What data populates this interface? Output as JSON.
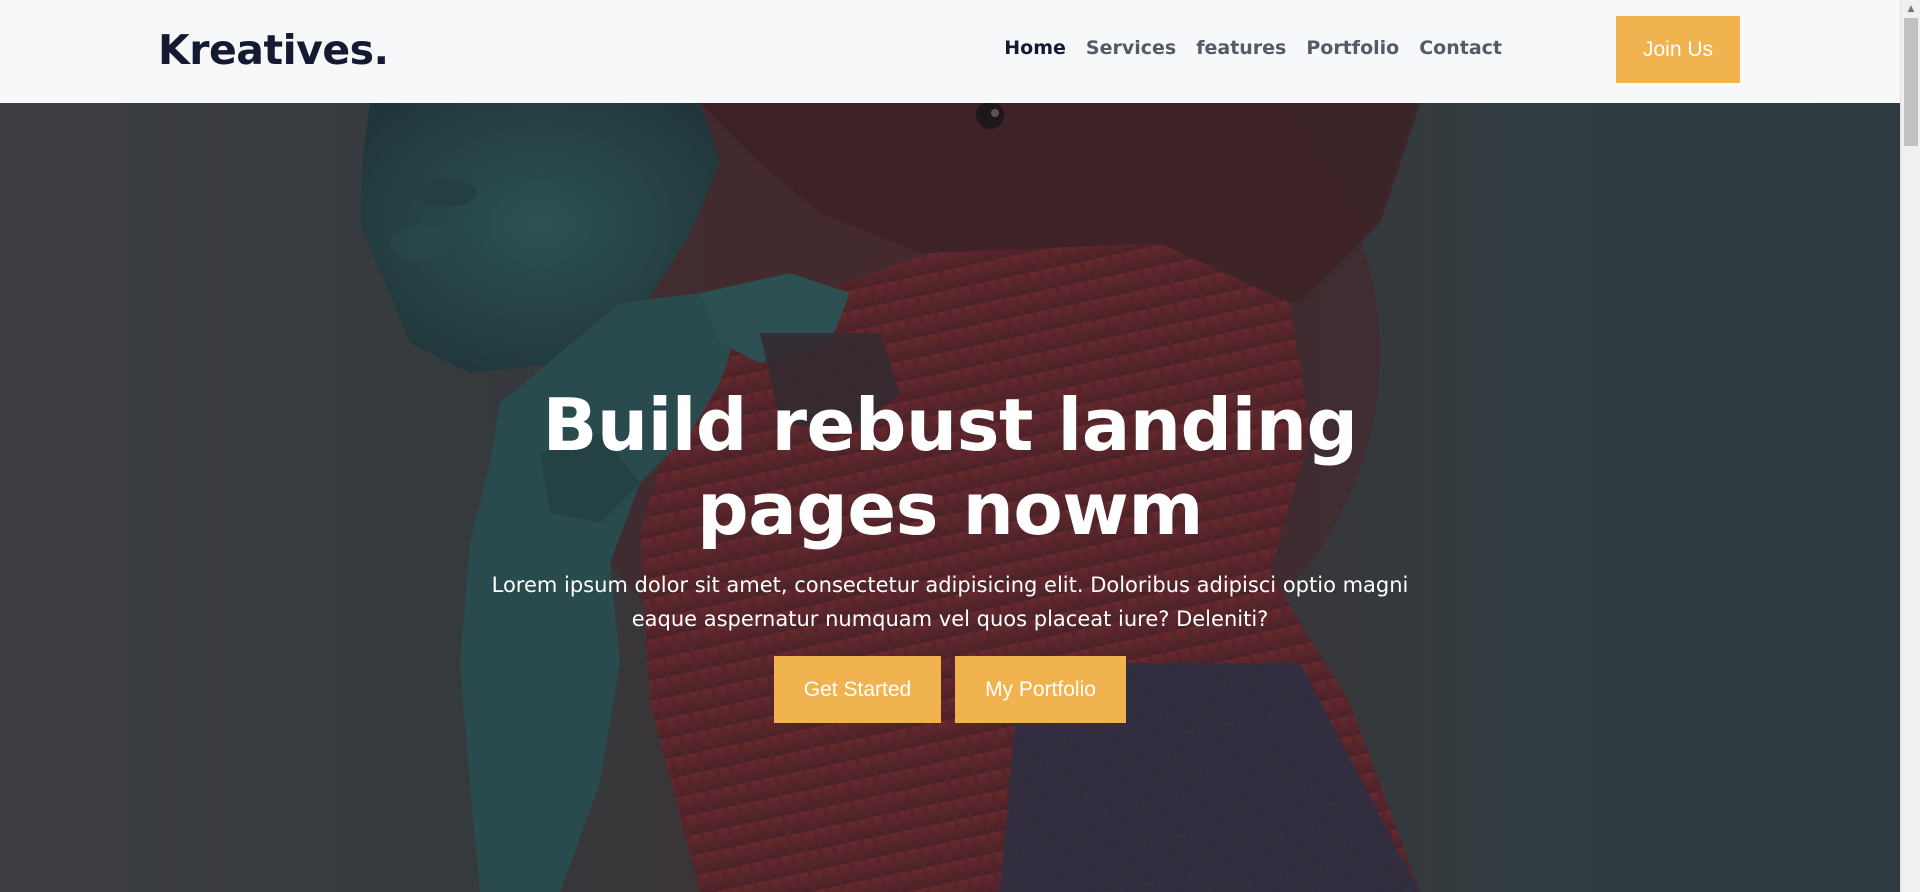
{
  "brand": {
    "name": "Kreatives."
  },
  "nav": {
    "links": [
      {
        "label": "Home",
        "active": true
      },
      {
        "label": "Services",
        "active": false
      },
      {
        "label": "features",
        "active": false
      },
      {
        "label": "Portfolio",
        "active": false
      },
      {
        "label": "Contact",
        "active": false
      }
    ],
    "cta_label": "Join Us"
  },
  "hero": {
    "title": "Build rebust landing pages nowm",
    "subtitle": "Lorem ipsum dolor sit amet, consectetur adipisicing elit. Doloribus adipisci optio magni eaque aspernatur numquam vel quos placeat iure? Deleniti?",
    "primary_button": "Get Started",
    "secondary_button": "My Portfolio"
  },
  "colors": {
    "accent": "#f0b350",
    "brand_text": "#151a33",
    "nav_text": "#555b66",
    "nav_background": "#f7f8fa"
  },
  "icons": {
    "scroll_up": "triangle-up-icon"
  }
}
